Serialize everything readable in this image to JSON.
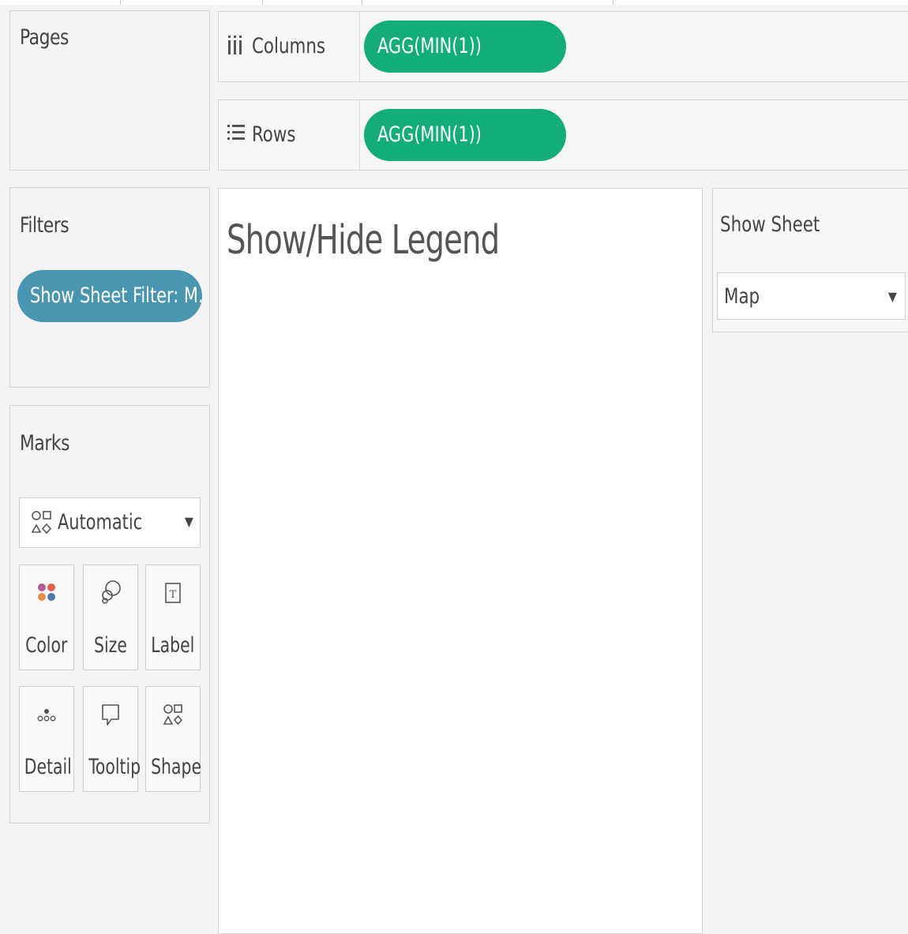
{
  "pages": {
    "title": "Pages"
  },
  "columns": {
    "label": "Columns",
    "icon": "columns-shelf-icon",
    "pill": "AGG(MIN(1))"
  },
  "rows": {
    "label": "Rows",
    "icon": "rows-shelf-icon",
    "pill": "AGG(MIN(1))"
  },
  "filters": {
    "title": "Filters",
    "pill": "Show Sheet Filter: M.."
  },
  "marks": {
    "title": "Marks",
    "mark_type": "Automatic",
    "cards": [
      {
        "label": "Color",
        "icon": "color-icon"
      },
      {
        "label": "Size",
        "icon": "size-icon"
      },
      {
        "label": "Label",
        "icon": "label-icon"
      },
      {
        "label": "Detail",
        "icon": "detail-icon"
      },
      {
        "label": "Tooltip",
        "icon": "tooltip-icon"
      },
      {
        "label": "Shape",
        "icon": "shape-icon"
      }
    ]
  },
  "canvas": {
    "title": "Show/Hide Legend"
  },
  "parameter": {
    "title": "Show Sheet",
    "value": "Map"
  },
  "colors": {
    "measure_pill": "#12ad78",
    "filter_pill": "#4996b2",
    "color_dots": [
      "#b45a93",
      "#e0604c",
      "#e88d49",
      "#4e79a7"
    ]
  }
}
